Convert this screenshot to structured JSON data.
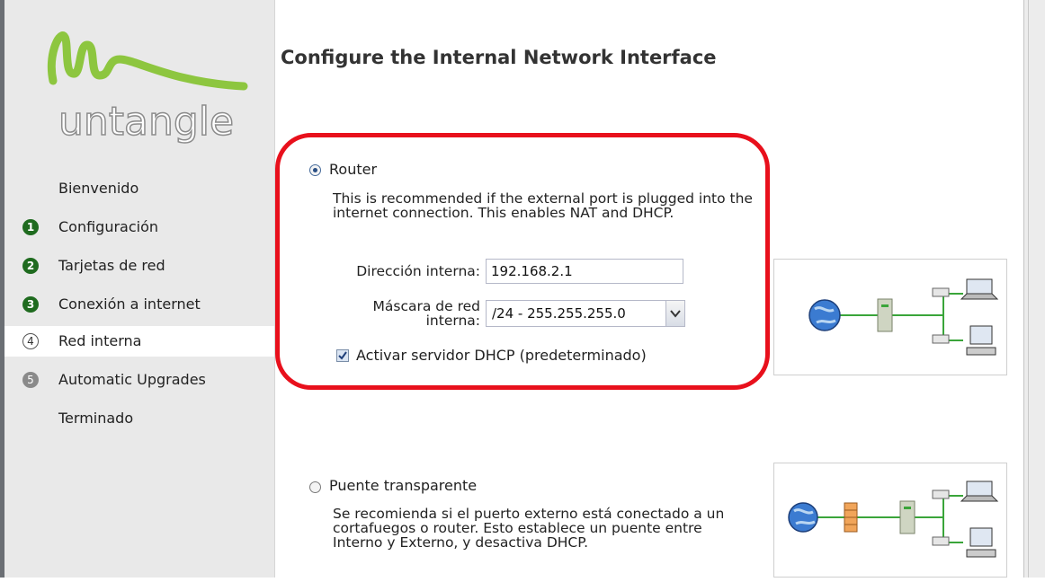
{
  "brand": {
    "logo_text": "untangle"
  },
  "sidebar": {
    "items": [
      {
        "label": "Bienvenido",
        "number": "",
        "state": "none"
      },
      {
        "label": "Configuración",
        "number": "1",
        "state": "done"
      },
      {
        "label": "Tarjetas de red",
        "number": "2",
        "state": "done"
      },
      {
        "label": "Conexión a internet",
        "number": "3",
        "state": "done"
      },
      {
        "label": "Red interna",
        "number": "4",
        "state": "active"
      },
      {
        "label": "Automatic Upgrades",
        "number": "5",
        "state": "future"
      },
      {
        "label": "Terminado",
        "number": "",
        "state": "none"
      }
    ]
  },
  "main": {
    "title": "Configure the Internal Network Interface",
    "router": {
      "label": "Router",
      "selected": true,
      "description": "This is recommended if the external port is plugged into the internet connection. This enables NAT and DHCP.",
      "address_label": "Dirección interna:",
      "address_value": "192.168.2.1",
      "mask_label": "Máscara de red interna:",
      "mask_value": "/24 - 255.255.255.0",
      "dhcp_label": "Activar servidor DHCP (predeterminado)",
      "dhcp_checked": true
    },
    "bridge": {
      "label": "Puente transparente",
      "selected": false,
      "description": "Se recomienda si el puerto externo está conectado a un cortafuegos o router. Esto establece un puente entre Interno y Externo, y desactiva DHCP."
    }
  },
  "colors": {
    "highlight": "#e8101c",
    "brand_green": "#8dc63f",
    "step_done": "#1f6b1f"
  }
}
